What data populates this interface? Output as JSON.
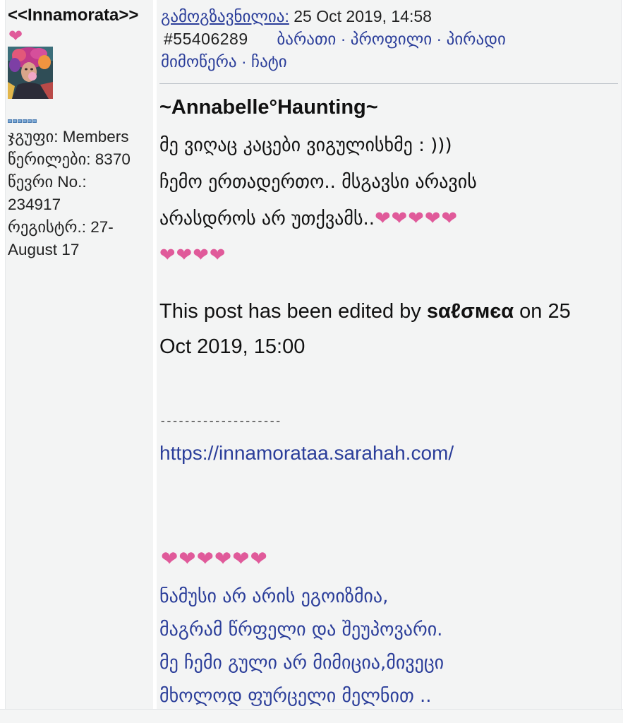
{
  "user": {
    "name": "<<Innamorata>>",
    "heart": "❤",
    "info": [
      "ჯგუფი: Members",
      "წერილები: 8370",
      "წევრი No.:",
      "234917",
      "რეგისტრ.: 27-",
      "August 17"
    ]
  },
  "post": {
    "sent_label": "გამოგზავნილია:",
    "sent_date": "25 Oct 2019, 14:58",
    "post_number": "#55406289",
    "links": {
      "rate": "ბარათი",
      "profile": "პროფილი",
      "private_line1": "პირადი",
      "private_line2": "მიმოწერა",
      "chat": "ჩატი"
    },
    "separator": "·"
  },
  "body": {
    "title": "~Annabelle°Haunting~",
    "lines": [
      "მე ვიღაც კაცები ვიგულისხმე : )))",
      "ჩემო ერთადერთო.. მსგავსი არავის",
      "არასდროს არ უთქვამს.."
    ],
    "hearts_line3": "❤❤❤❤❤",
    "hearts_line4": "❤❤❤❤",
    "edited_prefix": "This post has been edited by ",
    "edited_user": "ѕαℓσмєα",
    "edited_suffix": " on 25",
    "edited_line2": "Oct 2019, 15:00"
  },
  "signature": {
    "divider": "--------------------",
    "link": "https://innamorataa.sarahah.com/",
    "hearts": "❤❤❤❤❤❤",
    "poem": [
      "ნამუსი არ არის ეგოიზმია,",
      "მაგრამ წრფელი და შეუპოვარი.",
      "მე ჩემი გული არ მიმიცია,მივეცი",
      "მხოლოდ ფურცელი მელნით .."
    ]
  },
  "colors": {
    "link": "#2b3e9a",
    "heart": "#e05a9a",
    "panel": "#f3f4f4"
  }
}
